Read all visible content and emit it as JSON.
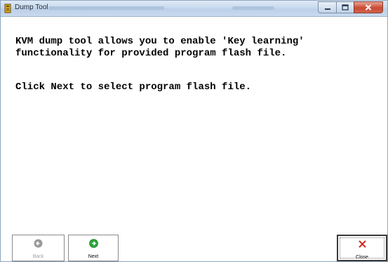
{
  "window": {
    "title": "Dump Tool",
    "title_suffix_blurred": "[obscured title text]",
    "title_right_blurred": "[obscured status text]",
    "controls": {
      "minimize_icon": "minimize-icon",
      "maximize_icon": "maximize-icon",
      "close_icon": "close-icon"
    }
  },
  "content": {
    "line1": "KVM dump tool allows you to enable 'Key learning'",
    "line2": "functionality for provided program flash file.",
    "line3": "Click Next to select program flash file."
  },
  "buttons": {
    "back": {
      "label": "Back",
      "icon": "back-arrow-icon",
      "enabled": false
    },
    "next": {
      "label": "Next",
      "icon": "next-arrow-icon",
      "enabled": true
    },
    "close": {
      "label": "Close",
      "icon": "close-x-icon",
      "enabled": true
    }
  },
  "colors": {
    "next_icon": "#2aa63a",
    "back_icon": "#9a9a9a",
    "close_icon": "#d02a20"
  }
}
